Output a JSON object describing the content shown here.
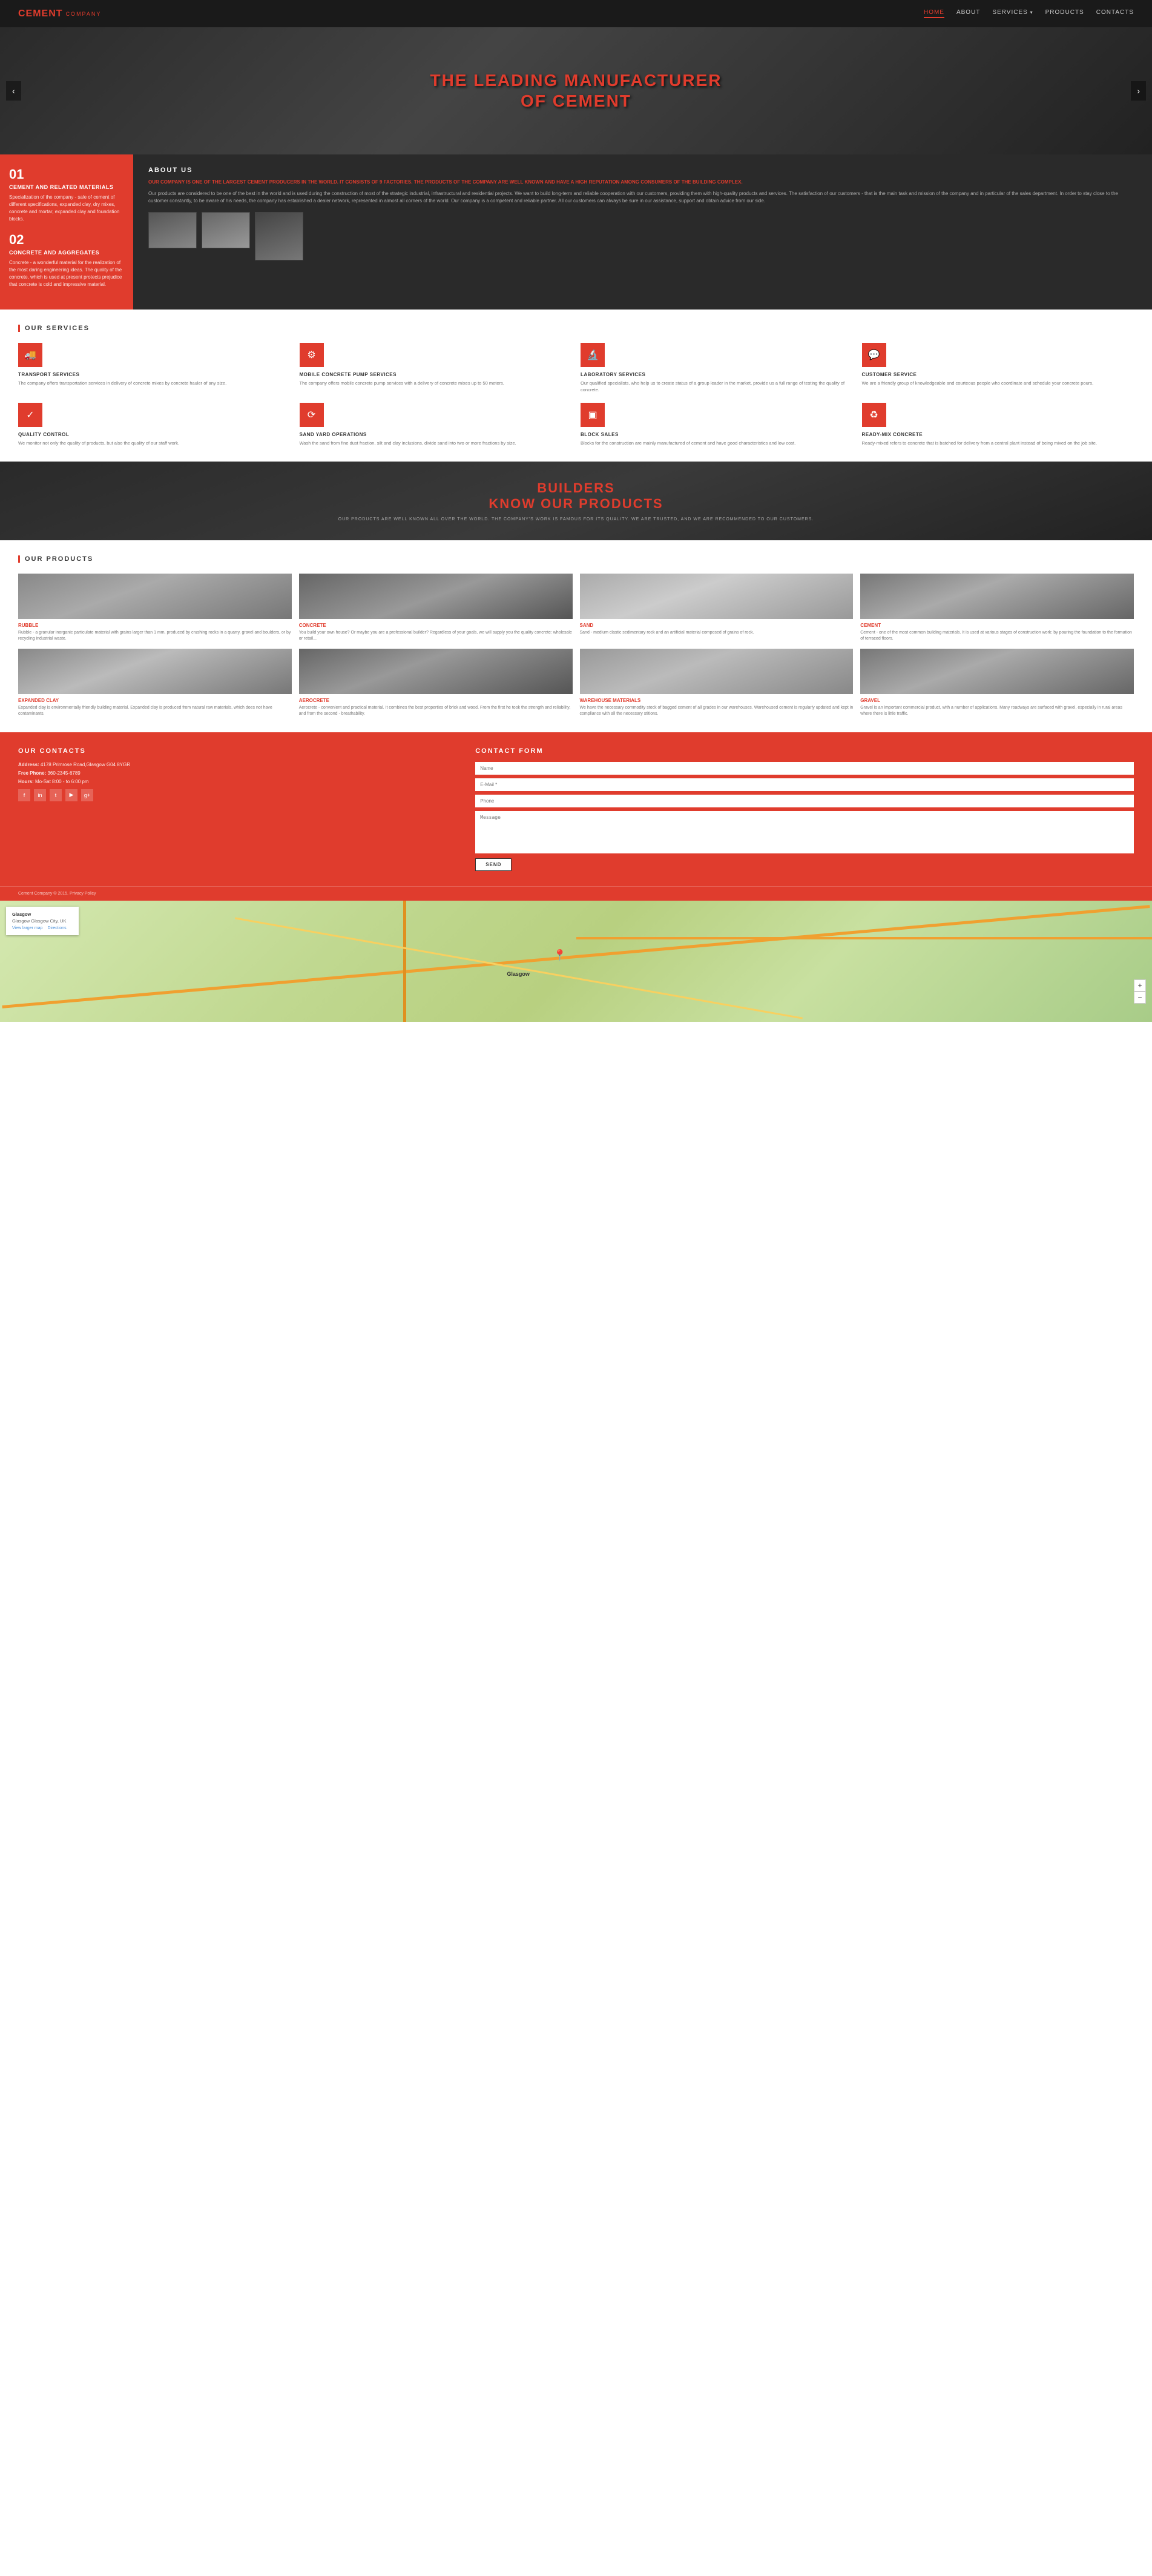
{
  "header": {
    "logo_cement": "CEMENT",
    "logo_company": "COMPANY",
    "nav": {
      "home": "HOME",
      "about": "ABOUT",
      "services": "SERVICES",
      "products": "PRODUCTS",
      "contacts": "CONTACTS"
    }
  },
  "hero": {
    "title_line1": "THE LEADING MANUFACTURER",
    "title_line2": "OF CEMENT",
    "arrow_left": "‹",
    "arrow_right": "›"
  },
  "about_left": {
    "num1": "01",
    "sub1": "CEMENT AND RELATED MATERIALS",
    "desc1": "Specialization of the company - sale of cement of different specifications, expanded clay, dry mixes, concrete and mortar, expanded clay and foundation blocks.",
    "num2": "02",
    "sub2": "CONCRETE AND AGGREGATES",
    "desc2": "Concrete - a wonderful material for the realization of the most daring engineering ideas. The quality of the concrete, which is used at present protects prejudice that concrete is cold and impressive material."
  },
  "about_right": {
    "title": "ABOUT US",
    "highlight": "OUR COMPANY IS ONE OF THE LARGEST CEMENT PRODUCERS IN THE WORLD. IT CONSISTS OF 9 FACTORIES. THE PRODUCTS OF THE COMPANY ARE WELL KNOWN AND HAVE A HIGH REPUTATION AMONG CONSUMERS OF THE BUILDING COMPLEX.",
    "body": "Our products are considered to be one of the best in the world and is used during the construction of most of the strategic industrial, infrastructural and residential projects. We want to build long-term and reliable cooperation with our customers, providing them with high-quality products and services. The satisfaction of our customers - that is the main task and mission of the company and in particular of the sales department. In order to stay close to the customer constantly, to be aware of his needs, the company has established a dealer network, represented in almost all corners of the world. Our company is a competent and reliable partner. All our customers can always be sure in our assistance, support and obtain advice from our side."
  },
  "services": {
    "title": "OUR SERVICES",
    "items": [
      {
        "icon": "🚚",
        "name": "TRANSPORT SERVICES",
        "desc": "The company offers transportation services in delivery of concrete mixes by concrete hauler of any size."
      },
      {
        "icon": "⚙",
        "name": "MOBILE CONCRETE PUMP SERVICES",
        "desc": "The company offers mobile concrete pump services with a delivery of concrete mixes up to 50 meters."
      },
      {
        "icon": "🔬",
        "name": "LABORATORY SERVICES",
        "desc": "Our qualified specialists, who help us to create status of a group leader in the market, provide us a full range of testing the quality of concrete."
      },
      {
        "icon": "💬",
        "name": "CUSTOMER SERVICE",
        "desc": "We are a friendly group of knowledgeable and courteous people who coordinate and schedule your concrete pours."
      },
      {
        "icon": "✓",
        "name": "QUALITY CONTROL",
        "desc": "We monitor not only the quality of products, but also the quality of our staff work."
      },
      {
        "icon": "⟳",
        "name": "SAND YARD OPERATIONS",
        "desc": "Wash the sand from fine dust fraction, silt and clay inclusions, divide sand into two or more fractions by size."
      },
      {
        "icon": "▣",
        "name": "BLOCK SALES",
        "desc": "Blocks for the construction are mainly manufactured of cement and have good characteristics and low cost."
      },
      {
        "icon": "♻",
        "name": "READY-MIX CONCRETE",
        "desc": "Ready-mixed refers to concrete that is batched for delivery from a central plant instead of being mixed on the job site."
      }
    ]
  },
  "promo": {
    "title_line1": "BUILDERS",
    "title_line2": "KNOW OUR PRODUCTS",
    "subtitle": "OUR PRODUCTS ARE WELL KNOWN ALL OVER THE WORLD. THE COMPANY'S WORK IS FAMOUS FOR ITS QUALITY. WE ARE TRUSTED, AND WE ARE RECOMMENDED TO OUR CUSTOMERS."
  },
  "products": {
    "title": "OUR PRODUCTS",
    "items": [
      {
        "name": "RUBBLE",
        "img_class": "img-rubble",
        "desc": "Rubble - a granular inorganic particulate material with grains larger than 1 mm, produced by crushing rocks in a quarry, gravel and boulders, or by recycling industrial waste."
      },
      {
        "name": "CONCRETE",
        "img_class": "img-concrete",
        "desc": "You build your own house? Or maybe you are a professional builder? Regardless of your goals, we will supply you the quality concrete: wholesale or retail..."
      },
      {
        "name": "SAND",
        "img_class": "img-sand",
        "desc": "Sand - medium clastic sedimentary rock and an artificial material composed of grains of rock."
      },
      {
        "name": "CEMENT",
        "img_class": "img-cement",
        "desc": "Cement - one of the most common building materials. It is used at various stages of construction work: by pouring the foundation to the formation of terraced floors."
      },
      {
        "name": "EXPANDED CLAY",
        "img_class": "img-clay",
        "desc": "Expanded clay is environmentally friendly building material. Expanded clay is produced from natural raw materials, which does not have contaminants."
      },
      {
        "name": "AEROCRETE",
        "img_class": "img-aero",
        "desc": "Aerocrete - convenient and practical material. It combines the best properties of brick and wood. From the first he took the strength and reliability, and from the second - breathability."
      },
      {
        "name": "WAREHOUSE MATERIALS",
        "img_class": "img-warehouse",
        "desc": "We have the necessary commodity stock of bagged cement of all grades in our warehouses. Warehoused cement is regularly updated and kept in compliance with all the necessary stitions."
      },
      {
        "name": "GRAVEL",
        "img_class": "img-gravel",
        "desc": "Gravel is an important commercial product, with a number of applications. Many roadways are surfaced with gravel, especially in rural areas where there is little traffic."
      }
    ]
  },
  "contacts": {
    "title": "OUR CONTACTS",
    "address_label": "Address:",
    "address_value": "4178 Primrose Road,Glasgow G04 8YGR",
    "hours_label": "Hours:",
    "hours_value": "Mo-Sat 8:00 - to 6:00 pm",
    "phone_label": "Free Phone:",
    "phone_value": "360-2345-6789",
    "social_icons": [
      "f",
      "in",
      "tw",
      "yt",
      "g+"
    ],
    "form_title": "CONTACT FORM",
    "name_placeholder": "Name",
    "email_placeholder": "E-Mail *",
    "phone_placeholder": "Phone",
    "message_placeholder": "Message",
    "send_label": "SEND"
  },
  "footer": {
    "copy": "Cement Company © 2015.",
    "privacy": "Privacy Policy"
  },
  "map": {
    "overlay_title": "Glasgow",
    "overlay_addr": "Glasgow Glasgow City, UK",
    "view_larger": "View larger map",
    "directions": "Directions",
    "pin_label": "Glasgow",
    "zoom_in": "+",
    "zoom_out": "−"
  }
}
